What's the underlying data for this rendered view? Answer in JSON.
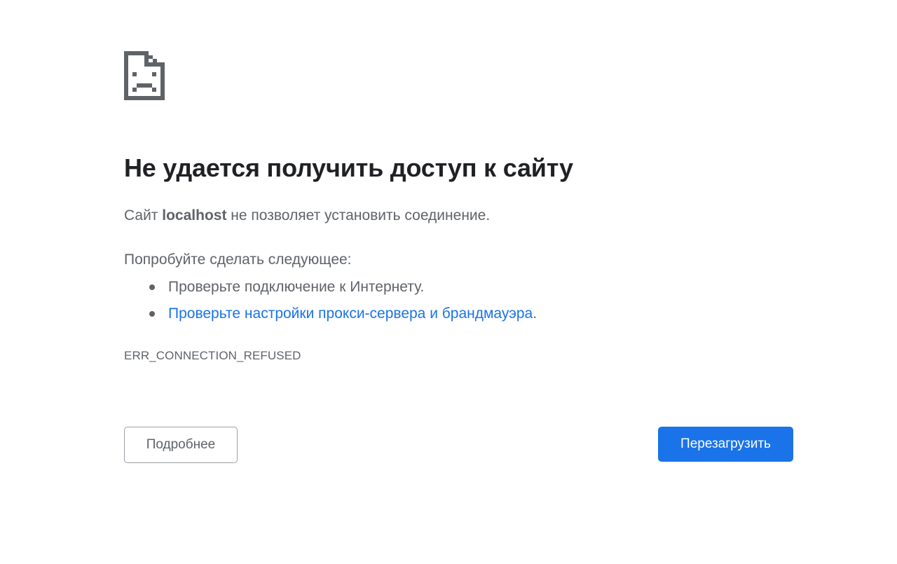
{
  "icon": {
    "name": "sad-page-icon",
    "color": "#5f6368"
  },
  "title": "Не удается получить доступ к сайту",
  "summary": {
    "prefix": "Сайт ",
    "host": "localhost",
    "suffix": " не позволяет установить соединение."
  },
  "suggestions": {
    "heading": "Попробуйте сделать следующее:",
    "items": [
      {
        "text": "Проверьте подключение к Интернету.",
        "link": "",
        "trailing": ""
      },
      {
        "text": "",
        "link": "Проверьте настройки прокси-сервера и брандмауэра",
        "trailing": "."
      }
    ]
  },
  "error_code": "ERR_CONNECTION_REFUSED",
  "buttons": {
    "details_label": "Подробнее",
    "reload_label": "Перезагрузить"
  },
  "colors": {
    "accent": "#1a73e8",
    "text_primary": "#202124",
    "text_secondary": "#5f6368"
  }
}
